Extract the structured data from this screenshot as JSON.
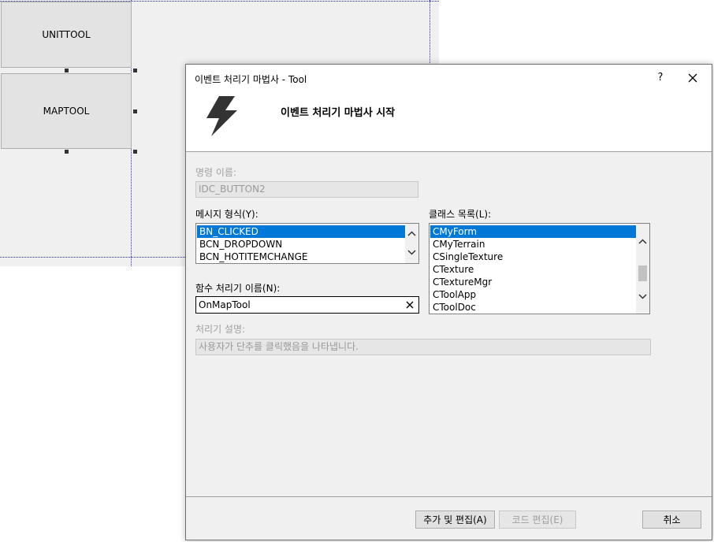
{
  "designer": {
    "buttons": [
      "UNITTOOL",
      "MAPTOOL"
    ]
  },
  "dialog": {
    "title": "이벤트 처리기 마법사 - Tool",
    "help_label": "?",
    "heading": "이벤트 처리기 마법사 시작",
    "header_icon": "lightning-bolt-icon",
    "command_name": {
      "label": "명령 이름:",
      "value": "IDC_BUTTON2"
    },
    "message_type": {
      "label": "메시지 형식(Y):",
      "items": [
        "BN_CLICKED",
        "BCN_DROPDOWN",
        "BCN_HOTITEMCHANGE"
      ],
      "selected": "BN_CLICKED"
    },
    "class_list": {
      "label": "클래스 목록(L):",
      "items": [
        "CMyForm",
        "CMyTerrain",
        "CSingleTexture",
        "CTexture",
        "CTextureMgr",
        "CToolApp",
        "CToolDoc"
      ],
      "selected": "CMyForm"
    },
    "function_name": {
      "label": "함수 처리기 이름(N):",
      "value": "OnMapTool"
    },
    "description": {
      "label": "처리기 설명:",
      "value": "사용자가 단추를 클릭했음을 나타냅니다."
    },
    "buttons": {
      "add_edit": "추가 및 편집(A)",
      "edit_code": "코드 편집(E)",
      "cancel": "취소"
    }
  },
  "colors": {
    "selection": "#0078d7",
    "dialog_bg": "#f0f0f0",
    "designer_grid": "#2a2ab8"
  }
}
